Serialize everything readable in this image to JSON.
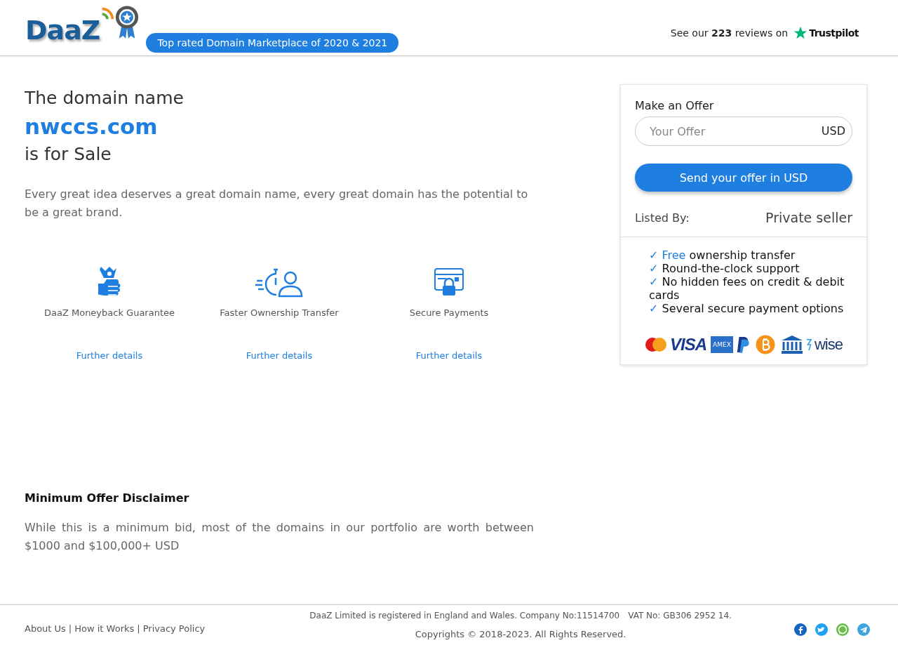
{
  "header": {
    "logo_text": "DaaZ",
    "badge": "Top rated Domain Marketplace of 2020 & 2021",
    "reviews": {
      "before": "See our",
      "count": "223",
      "after": "reviews on",
      "brand": "Trustpilot"
    }
  },
  "hero": {
    "line1": "The domain name",
    "domain": "nwccs.com",
    "line3": "is for Sale",
    "tagline": "Every great idea deserves a great domain name, every great domain has the potential to be a great brand."
  },
  "features": [
    {
      "kind": "money",
      "title": "DaaZ Moneyback Guarantee",
      "link": "Further details"
    },
    {
      "kind": "transfer",
      "title": "Faster Ownership Transfer",
      "link": "Further details"
    },
    {
      "kind": "secure",
      "title": "Secure Payments",
      "link": "Further details"
    }
  ],
  "offer": {
    "title": "Make an Offer",
    "placeholder": "Your Offer",
    "currency": "USD",
    "button": "Send your offer in USD",
    "listed_label": "Listed By:",
    "listed_value": "Private seller",
    "benefits": [
      {
        "mark": "✓",
        "highlight": "Free",
        "text": " ownership transfer"
      },
      {
        "mark": "✓",
        "text": "Round-the-clock support"
      },
      {
        "mark": "✓",
        "text": "No hidden fees on credit & debit cards"
      },
      {
        "mark": "✓",
        "text": "Several secure payment options"
      }
    ],
    "payments": [
      {
        "kind": "mastercard"
      },
      {
        "kind": "visa",
        "label": "VISA"
      },
      {
        "kind": "amex",
        "label": "AMEX"
      },
      {
        "kind": "paypal"
      },
      {
        "kind": "bitcoin"
      },
      {
        "kind": "bank"
      },
      {
        "kind": "wise",
        "label": "wise"
      }
    ]
  },
  "disclaimer": {
    "title": "Minimum Offer Disclaimer",
    "text": "While this is a minimum bid, most of the domains in our portfolio are worth between $1000 and $100,000+ USD"
  },
  "footer": {
    "links": [
      "About Us",
      "How it Works",
      "Privacy Policy"
    ],
    "separator": "|",
    "registration": "DaaZ Limited is registered in England and Wales. Company No:11514700",
    "vat": "VAT No: GB306 2952 14.",
    "copyright": "Copyrights © 2018-2023. All Rights Reserved.",
    "social": [
      {
        "kind": "facebook",
        "color": "#1565c0"
      },
      {
        "kind": "twitter",
        "color": "#1da1f2"
      },
      {
        "kind": "whatsapp",
        "color": "#6abf4b"
      },
      {
        "kind": "telegram",
        "color": "#3fa3dc"
      }
    ]
  }
}
